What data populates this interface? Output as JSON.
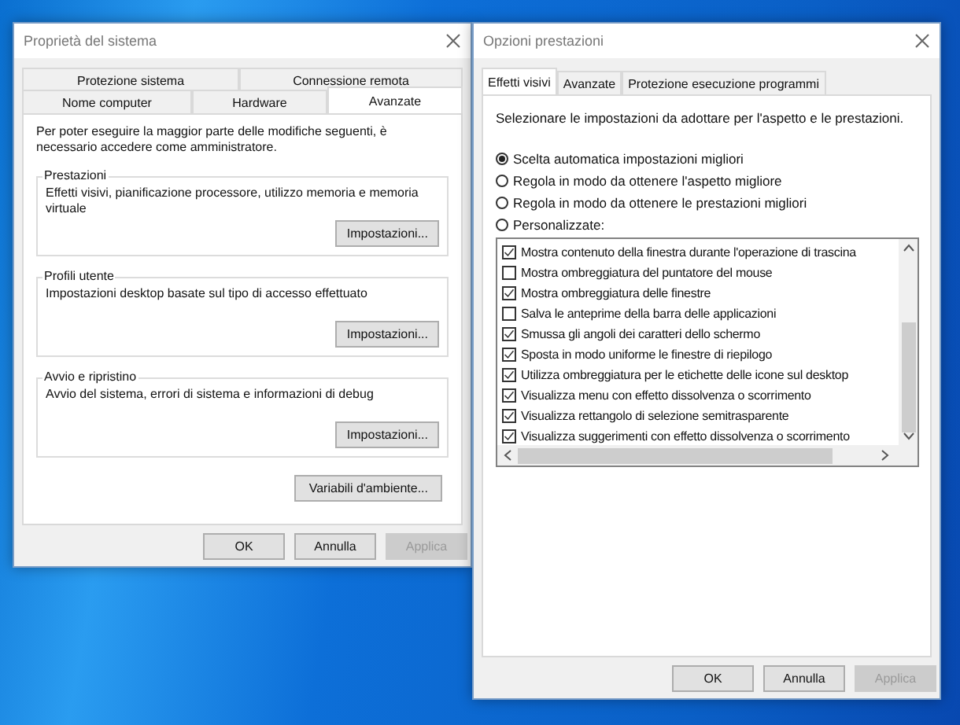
{
  "system_properties": {
    "title": "Proprietà del sistema",
    "tab_rows": [
      [
        {
          "label": "Protezione sistema",
          "selected": false
        },
        {
          "label": "Connessione remota",
          "selected": false
        }
      ],
      [
        {
          "label": "Nome computer",
          "selected": false
        },
        {
          "label": "Hardware",
          "selected": false
        },
        {
          "label": "Avanzate",
          "selected": true
        }
      ]
    ],
    "intro": "Per poter eseguire la maggior parte delle modifiche seguenti, è necessario accedere come amministratore.",
    "groups": [
      {
        "title": "Prestazioni",
        "description": "Effetti visivi, pianificazione processore, utilizzo memoria e memoria virtuale",
        "button": "Impostazioni..."
      },
      {
        "title": "Profili utente",
        "description": "Impostazioni desktop basate sul tipo di accesso effettuato",
        "button": "Impostazioni..."
      },
      {
        "title": "Avvio e ripristino",
        "description": "Avvio del sistema, errori di sistema e informazioni di debug",
        "button": "Impostazioni..."
      }
    ],
    "environment_button": "Variabili d'ambiente...",
    "buttons": [
      {
        "label": "OK",
        "disabled": false
      },
      {
        "label": "Annulla",
        "disabled": false
      },
      {
        "label": "Applica",
        "disabled": true
      }
    ]
  },
  "performance_options": {
    "title": "Opzioni prestazioni",
    "tabs": [
      {
        "label": "Effetti visivi",
        "selected": true
      },
      {
        "label": "Avanzate",
        "selected": false
      },
      {
        "label": "Protezione esecuzione programmi",
        "selected": false
      }
    ],
    "intro": "Selezionare le impostazioni da adottare per l'aspetto e le prestazioni.",
    "radios": [
      {
        "label": "Scelta automatica impostazioni migliori",
        "selected": true
      },
      {
        "label": "Regola in modo da ottenere l'aspetto migliore",
        "selected": false
      },
      {
        "label": "Regola in modo da ottenere le prestazioni migliori",
        "selected": false
      },
      {
        "label": "Personalizzate:",
        "selected": false
      }
    ],
    "effects": [
      {
        "label": "Mostra contenuto della finestra durante l'operazione di trascina",
        "checked": true
      },
      {
        "label": "Mostra ombreggiatura del puntatore del mouse",
        "checked": false
      },
      {
        "label": "Mostra ombreggiatura delle finestre",
        "checked": true
      },
      {
        "label": "Salva le anteprime della barra delle applicazioni",
        "checked": false
      },
      {
        "label": "Smussa gli angoli dei caratteri dello schermo",
        "checked": true
      },
      {
        "label": "Sposta in modo uniforme le finestre di riepilogo",
        "checked": true
      },
      {
        "label": "Utilizza ombreggiatura per le etichette delle icone sul desktop",
        "checked": true
      },
      {
        "label": "Visualizza menu con effetto dissolvenza o scorrimento",
        "checked": true
      },
      {
        "label": "Visualizza rettangolo di selezione semitrasparente",
        "checked": true
      },
      {
        "label": "Visualizza suggerimenti con effetto dissolvenza o scorrimento",
        "checked": true
      }
    ],
    "buttons": [
      {
        "label": "OK",
        "disabled": false
      },
      {
        "label": "Annulla",
        "disabled": false
      },
      {
        "label": "Applica",
        "disabled": true
      }
    ]
  }
}
